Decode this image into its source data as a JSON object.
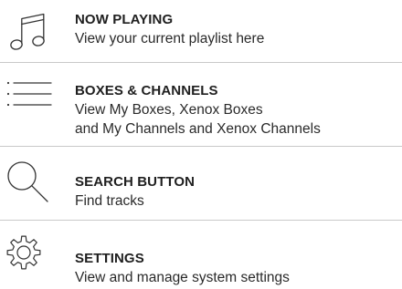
{
  "menu": {
    "items": [
      {
        "title": "NOW PLAYING",
        "desc": [
          "View your current playlist here"
        ],
        "icon": "music-note-icon"
      },
      {
        "title": "BOXES & CHANNELS",
        "desc": [
          "View My Boxes, Xenox Boxes",
          "and My Channels and Xenox Channels"
        ],
        "icon": "list-icon"
      },
      {
        "title": "SEARCH BUTTON",
        "desc": [
          "Find tracks"
        ],
        "icon": "search-icon"
      },
      {
        "title": "SETTINGS",
        "desc": [
          "View and manage system settings"
        ],
        "icon": "gear-icon"
      }
    ]
  },
  "colors": {
    "text": "#1f1f1f",
    "icon_stroke": "#333333",
    "divider": "#c9c9c9",
    "background": "#ffffff"
  }
}
